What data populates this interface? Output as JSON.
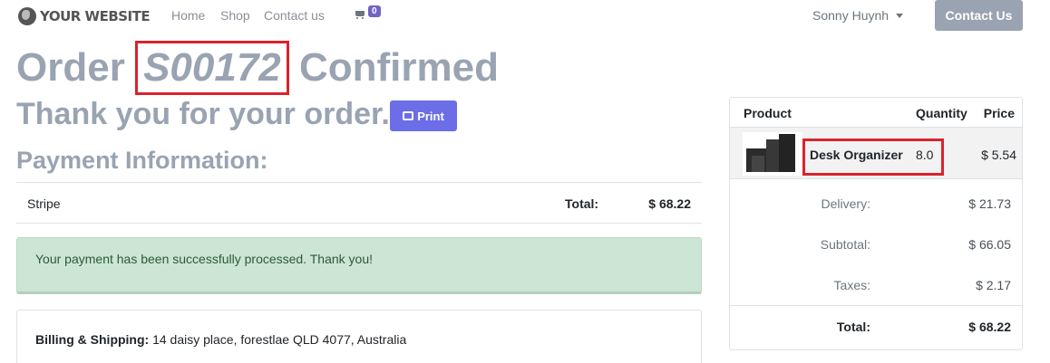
{
  "nav": {
    "logo_text": "YOUR WEBSITE",
    "links": [
      "Home",
      "Shop",
      "Contact us"
    ],
    "cart_count": "0",
    "user_name": "Sonny Huynh",
    "contact_button": "Contact Us"
  },
  "heading": {
    "order_prefix": "Order",
    "order_ref": "S00172",
    "order_suffix": "Confirmed",
    "thanks": "Thank you for your order.",
    "print_label": "Print",
    "payment_info": "Payment Information:"
  },
  "payment": {
    "method": "Stripe",
    "total_label": "Total:",
    "total_value": "$ 68.22",
    "success_message": "Your payment has been successfully processed. Thank you!"
  },
  "billing": {
    "label": "Billing & Shipping:",
    "address": "14 daisy place, forestlae QLD 4077, Australia"
  },
  "summary": {
    "headers": {
      "product": "Product",
      "quantity": "Quantity",
      "price": "Price"
    },
    "item": {
      "name": "Desk Organizer",
      "quantity": "8.0",
      "price": "$ 5.54"
    },
    "delivery_label": "Delivery:",
    "delivery_value": "$ 21.73",
    "subtotal_label": "Subtotal:",
    "subtotal_value": "$ 66.05",
    "taxes_label": "Taxes:",
    "taxes_value": "$ 2.17",
    "total_label": "Total:",
    "total_value": "$ 68.22"
  },
  "colors": {
    "accent": "#6b6ee6",
    "heading": "#9aa3b1",
    "highlight_box": "#d9232d",
    "success_bg": "#cde5d4"
  }
}
